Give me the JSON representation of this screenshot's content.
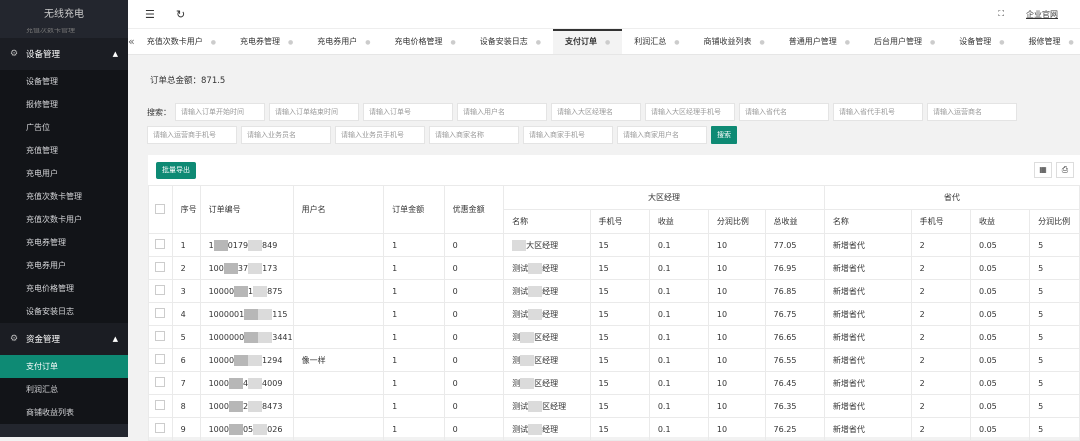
{
  "sidebar": {
    "brand": "无线充电",
    "partial_item": "充值次数卡管理",
    "group1": "设备管理",
    "group1_items": [
      "设备管理",
      "报修管理",
      "广告位",
      "充值管理",
      "充电用户",
      "充值次数卡管理",
      "充值次数卡用户",
      "充电券管理",
      "充电券用户",
      "充电价格管理",
      "设备安装日志"
    ],
    "group2": "资金管理",
    "group2_items": [
      "支付订单",
      "利润汇总",
      "商铺收益列表"
    ],
    "active": "支付订单"
  },
  "topbar": {
    "menu_icon": "☰",
    "refresh_icon": "↻",
    "fullscreen_icon": "⛶",
    "site_link": "企业官网"
  },
  "tabs": [
    "充值次数卡用户",
    "充电券管理",
    "充电券用户",
    "充电价格管理",
    "设备安装日志",
    "支付订单",
    "利润汇总",
    "商铺收益列表",
    "普通用户管理",
    "后台用户管理",
    "设备管理",
    "报修管理"
  ],
  "active_tab": "支付订单",
  "summary": {
    "total_label": "订单总金额：871.5"
  },
  "search": {
    "label": "搜索：",
    "row1": [
      "请输入订单开始时间",
      "请输入订单结束时间",
      "请输入订单号",
      "请输入用户名",
      "请输入大区经理名",
      "请输入大区经理手机号",
      "请输入省代名",
      "请输入省代手机号",
      "请输入运营商名"
    ],
    "row2": [
      "请输入运营商手机号",
      "请输入业务员名",
      "请输入业务员手机号",
      "请输入商家名称",
      "请输入商家手机号",
      "请输入商家用户名"
    ],
    "button": "搜索"
  },
  "table": {
    "export_button": "批量导出",
    "headers": {
      "seq": "序号",
      "order_no": "订单编号",
      "username": "用户名",
      "amount": "订单金额",
      "discount": "优惠金额",
      "region_group": "大区经理",
      "province_group": "省代",
      "name": "名称",
      "phone": "手机号",
      "income": "收益",
      "ratio": "分润比例",
      "total_income": "总收益"
    },
    "rows": [
      {
        "seq": "1",
        "order_a": "1",
        "order_b": "0179",
        "order_c": "849",
        "user": "",
        "amount": "1",
        "discount": "0",
        "rname_a": "",
        "rname_b": "大区经理",
        "rphone": "15",
        "rincome": "0.1",
        "rratio": "10",
        "rtotal": "77.05",
        "pname": "新增省代",
        "pphone": "2",
        "pincome": "0.05",
        "pratio": "5"
      },
      {
        "seq": "2",
        "order_a": "100",
        "order_b": "37",
        "order_c": "173",
        "user": "",
        "amount": "1",
        "discount": "0",
        "rname_a": "测试",
        "rname_b": "经理",
        "rphone": "15",
        "rincome": "0.1",
        "rratio": "10",
        "rtotal": "76.95",
        "pname": "新增省代",
        "pphone": "2",
        "pincome": "0.05",
        "pratio": "5"
      },
      {
        "seq": "3",
        "order_a": "10000",
        "order_b": "1",
        "order_c": "875",
        "user": "",
        "amount": "1",
        "discount": "0",
        "rname_a": "测试",
        "rname_b": "经理",
        "rphone": "15",
        "rincome": "0.1",
        "rratio": "10",
        "rtotal": "76.85",
        "pname": "新增省代",
        "pphone": "2",
        "pincome": "0.05",
        "pratio": "5"
      },
      {
        "seq": "4",
        "order_a": "1000001",
        "order_b": "",
        "order_c": "115",
        "user": "",
        "amount": "1",
        "discount": "0",
        "rname_a": "测试",
        "rname_b": "经理",
        "rphone": "15",
        "rincome": "0.1",
        "rratio": "10",
        "rtotal": "76.75",
        "pname": "新增省代",
        "pphone": "2",
        "pincome": "0.05",
        "pratio": "5"
      },
      {
        "seq": "5",
        "order_a": "1000000",
        "order_b": "",
        "order_c": "3441",
        "user": "",
        "amount": "1",
        "discount": "0",
        "rname_a": "测",
        "rname_b": "区经理",
        "rphone": "15",
        "rincome": "0.1",
        "rratio": "10",
        "rtotal": "76.65",
        "pname": "新增省代",
        "pphone": "2",
        "pincome": "0.05",
        "pratio": "5"
      },
      {
        "seq": "6",
        "order_a": "10000",
        "order_b": "",
        "order_c": "1294",
        "user": "像一样",
        "amount": "1",
        "discount": "0",
        "rname_a": "测",
        "rname_b": "区经理",
        "rphone": "15",
        "rincome": "0.1",
        "rratio": "10",
        "rtotal": "76.55",
        "pname": "新增省代",
        "pphone": "2",
        "pincome": "0.05",
        "pratio": "5"
      },
      {
        "seq": "7",
        "order_a": "1000",
        "order_b": "4",
        "order_c": "4009",
        "user": "",
        "amount": "1",
        "discount": "0",
        "rname_a": "测",
        "rname_b": "区经理",
        "rphone": "15",
        "rincome": "0.1",
        "rratio": "10",
        "rtotal": "76.45",
        "pname": "新增省代",
        "pphone": "2",
        "pincome": "0.05",
        "pratio": "5"
      },
      {
        "seq": "8",
        "order_a": "1000",
        "order_b": "2",
        "order_c": "8473",
        "user": "",
        "amount": "1",
        "discount": "0",
        "rname_a": "测试",
        "rname_b": "区经理",
        "rphone": "15",
        "rincome": "0.1",
        "rratio": "10",
        "rtotal": "76.35",
        "pname": "新增省代",
        "pphone": "2",
        "pincome": "0.05",
        "pratio": "5"
      },
      {
        "seq": "9",
        "order_a": "1000",
        "order_b": "05",
        "order_c": "026",
        "user": "",
        "amount": "1",
        "discount": "0",
        "rname_a": "测试",
        "rname_b": "经理",
        "rphone": "15",
        "rincome": "0.1",
        "rratio": "10",
        "rtotal": "76.25",
        "pname": "新增省代",
        "pphone": "2",
        "pincome": "0.05",
        "pratio": "5"
      }
    ]
  }
}
